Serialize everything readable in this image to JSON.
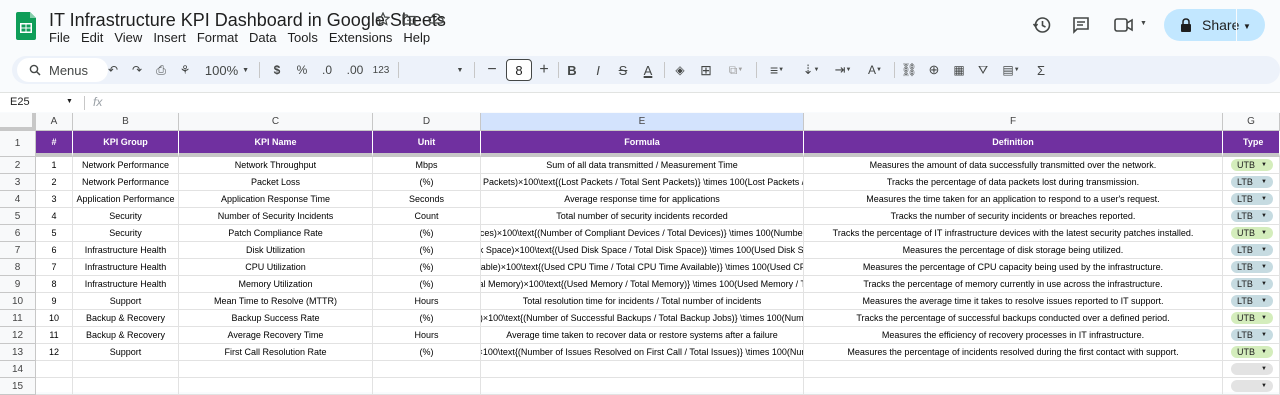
{
  "doc_title": "IT Infrastructure KPI Dashboard in Google Sheets",
  "menu": [
    "File",
    "Edit",
    "View",
    "Insert",
    "Format",
    "Data",
    "Tools",
    "Extensions",
    "Help"
  ],
  "share_label": "Share",
  "toolbar": {
    "menus_label": "Menus",
    "zoom": "100%",
    "currency": "$",
    "percent": "%",
    "dec_decrease": ".0",
    "dec_increase": ".00",
    "number_format": "123",
    "font_size": "8"
  },
  "formula_bar": {
    "name_box": "E25",
    "fx": "fx"
  },
  "columns": [
    "A",
    "B",
    "C",
    "D",
    "E",
    "F",
    "G"
  ],
  "headers": [
    "#",
    "KPI Group",
    "KPI Name",
    "Unit",
    "Formula",
    "Definition",
    "Type"
  ],
  "rows": [
    {
      "n": "1",
      "group": "Network Performance",
      "name": "Network Throughput",
      "unit": "Mbps",
      "formula": "Sum of all data transmitted / Measurement Time",
      "definition": "Measures the amount of data successfully transmitted over the network.",
      "type": "UTB"
    },
    {
      "n": "2",
      "group": "Network Performance",
      "name": "Packet Loss",
      "unit": "(%)",
      "formula": "ent Packets)×100\\text{(Lost Packets / Total Sent Packets)} \\times 100(Lost Packets / To",
      "definition": "Tracks the percentage of data packets lost during transmission.",
      "type": "LTB"
    },
    {
      "n": "3",
      "group": "Application Performance",
      "name": "Application Response Time",
      "unit": "Seconds",
      "formula": "Average response time for applications",
      "definition": "Measures the time taken for an application to respond to a user's request.",
      "type": "LTB"
    },
    {
      "n": "4",
      "group": "Security",
      "name": "Number of Security Incidents",
      "unit": "Count",
      "formula": "Total number of security incidents recorded",
      "definition": "Tracks the number of security incidents or breaches reported.",
      "type": "LTB"
    },
    {
      "n": "5",
      "group": "Security",
      "name": "Patch Compliance Rate",
      "unit": "(%)",
      "formula": "evices)×100\\text{(Number of Compliant Devices / Total Devices)} \\times 100(Number of",
      "definition": "Tracks the percentage of IT infrastructure devices with the latest security patches installed.",
      "type": "UTB"
    },
    {
      "n": "6",
      "group": "Infrastructure Health",
      "name": "Disk Utilization",
      "unit": "(%)",
      "formula": "Disk Space)×100\\text{(Used Disk Space / Total Disk Space)} \\times 100(Used Disk Spac",
      "definition": "Measures the percentage of disk storage being utilized.",
      "type": "LTB"
    },
    {
      "n": "7",
      "group": "Infrastructure Health",
      "name": "CPU Utilization",
      "unit": "(%)",
      "formula": "ailable)×100\\text{(Used CPU Time / Total CPU Time Available)} \\times 100(Used CPU",
      "definition": "Measures the percentage of CPU capacity being used by the infrastructure.",
      "type": "LTB"
    },
    {
      "n": "8",
      "group": "Infrastructure Health",
      "name": "Memory Utilization",
      "unit": "(%)",
      "formula": "Total Memory)×100\\text{(Used Memory / Total Memory)} \\times 100(Used Memory / Tota",
      "definition": "Tracks the percentage of memory currently in use across the infrastructure.",
      "type": "LTB"
    },
    {
      "n": "9",
      "group": "Support",
      "name": "Mean Time to Resolve (MTTR)",
      "unit": "Hours",
      "formula": "Total resolution time for incidents / Total number of incidents",
      "definition": "Measures the average time it takes to resolve issues reported to IT support.",
      "type": "LTB"
    },
    {
      "n": "10",
      "group": "Backup & Recovery",
      "name": "Backup Success Rate",
      "unit": "(%)",
      "formula": "bs)×100\\text{(Number of Successful Backups / Total Backup Jobs)} \\times 100(Numbe",
      "definition": "Tracks the percentage of successful backups conducted over a defined period.",
      "type": "UTB"
    },
    {
      "n": "11",
      "group": "Backup & Recovery",
      "name": "Average Recovery Time",
      "unit": "Hours",
      "formula": "Average time taken to recover data or restore systems after a failure",
      "definition": "Measures the efficiency of recovery processes in IT infrastructure.",
      "type": "LTB"
    },
    {
      "n": "12",
      "group": "Support",
      "name": "First Call Resolution Rate",
      "unit": "(%)",
      "formula": "s)×100\\text{(Number of Issues Resolved on First Call / Total Issues)} \\times 100(Numb",
      "definition": "Measures the percentage of incidents resolved during the first contact with support.",
      "type": "UTB"
    }
  ],
  "empty_rows": [
    "14",
    "15"
  ],
  "colors": {
    "header_bg": "#7030a0",
    "utb_chip": "#d4edbc",
    "ltb_chip": "#c6dbe1",
    "share_bg": "#c2e7ff",
    "selected_col": "#d3e3fd"
  }
}
